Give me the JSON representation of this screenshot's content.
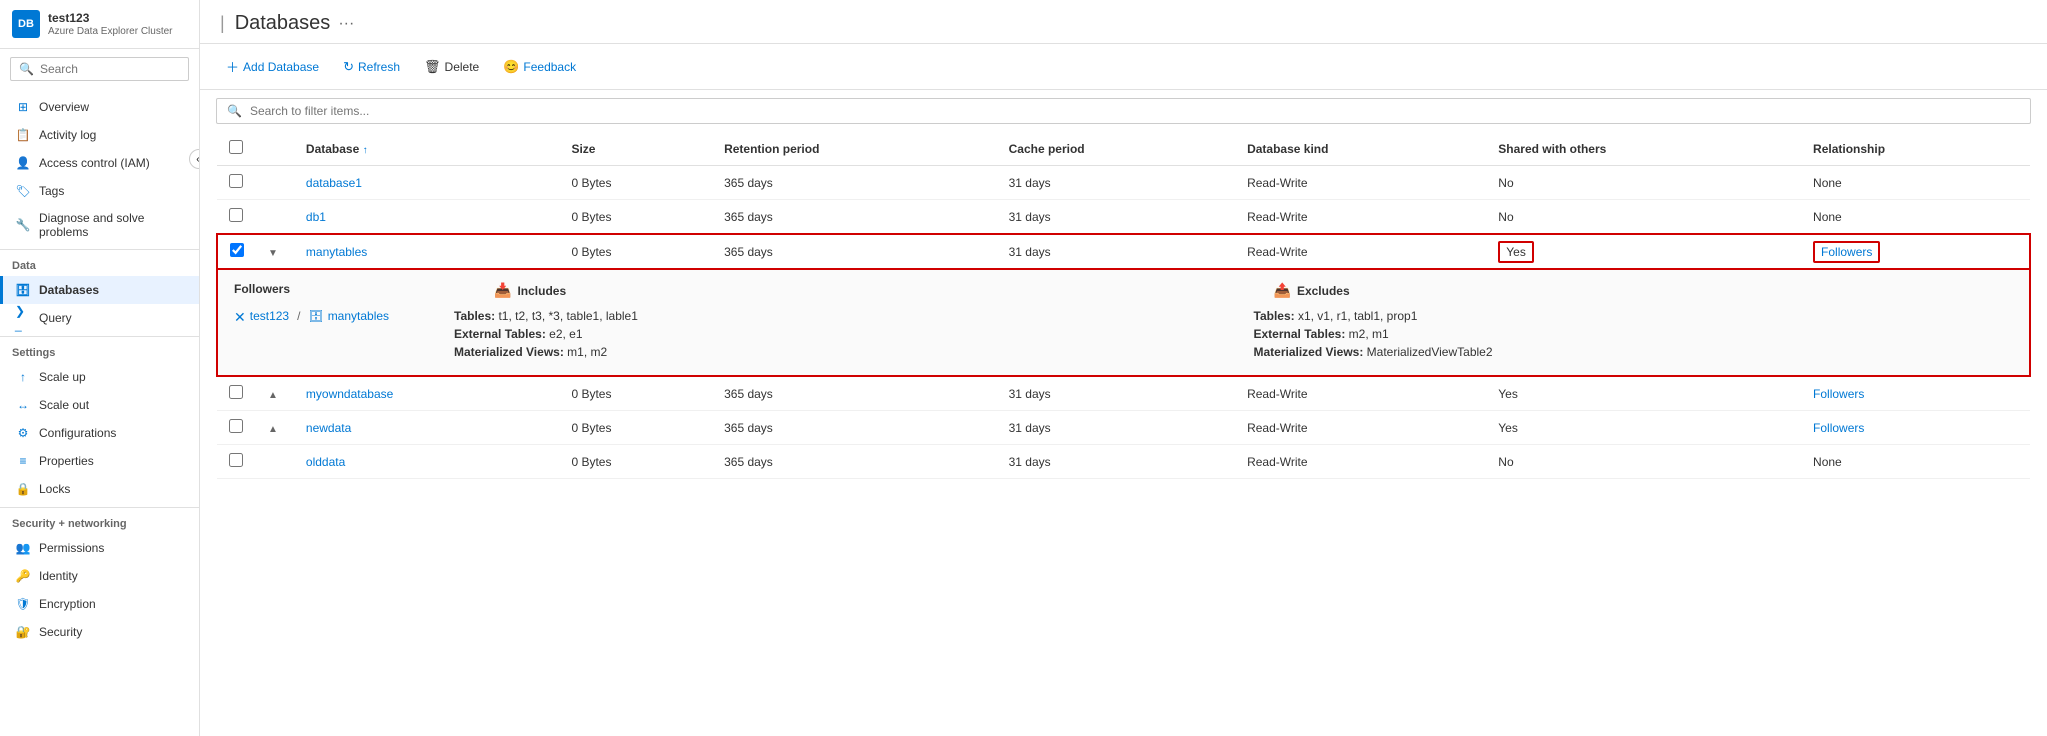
{
  "sidebar": {
    "logo_text": "DB",
    "cluster_name": "test123",
    "cluster_subtitle": "Azure Data Explorer Cluster",
    "search_placeholder": "Search",
    "collapse_icon": "«",
    "nav": {
      "general_items": [
        {
          "id": "overview",
          "label": "Overview",
          "icon": "overview"
        },
        {
          "id": "activity-log",
          "label": "Activity log",
          "icon": "activity"
        },
        {
          "id": "access-control",
          "label": "Access control (IAM)",
          "icon": "access"
        },
        {
          "id": "tags",
          "label": "Tags",
          "icon": "tags"
        },
        {
          "id": "diagnose",
          "label": "Diagnose and solve problems",
          "icon": "diagnose"
        }
      ],
      "data_section": "Data",
      "data_items": [
        {
          "id": "databases",
          "label": "Databases",
          "icon": "db",
          "active": true
        },
        {
          "id": "query",
          "label": "Query",
          "icon": "query"
        }
      ],
      "settings_section": "Settings",
      "settings_items": [
        {
          "id": "scale-up",
          "label": "Scale up",
          "icon": "scale"
        },
        {
          "id": "scale-out",
          "label": "Scale out",
          "icon": "scale-out"
        },
        {
          "id": "configurations",
          "label": "Configurations",
          "icon": "config"
        },
        {
          "id": "properties",
          "label": "Properties",
          "icon": "props"
        },
        {
          "id": "locks",
          "label": "Locks",
          "icon": "locks"
        }
      ],
      "security_section": "Security + networking",
      "security_items": [
        {
          "id": "permissions",
          "label": "Permissions",
          "icon": "permissions"
        },
        {
          "id": "identity",
          "label": "Identity",
          "icon": "identity"
        },
        {
          "id": "encryption",
          "label": "Encryption",
          "icon": "encryption"
        },
        {
          "id": "security",
          "label": "Security",
          "icon": "security"
        }
      ]
    }
  },
  "page": {
    "title": "Databases",
    "more_icon": "···"
  },
  "toolbar": {
    "add_db_label": "Add Database",
    "refresh_label": "Refresh",
    "delete_label": "Delete",
    "feedback_label": "Feedback"
  },
  "search": {
    "placeholder": "Search to filter items..."
  },
  "table": {
    "columns": [
      "",
      "",
      "Database",
      "Size",
      "Retention period",
      "Cache period",
      "Database kind",
      "Shared with others",
      "Relationship"
    ],
    "rows": [
      {
        "id": "database1",
        "name": "database1",
        "size": "0 Bytes",
        "retention": "365 days",
        "cache": "31 days",
        "kind": "Read-Write",
        "shared": "No",
        "relationship": "None",
        "expanded": false,
        "has_followers": false,
        "highlight_row": false,
        "highlight_relationship": false
      },
      {
        "id": "db1",
        "name": "db1",
        "size": "0 Bytes",
        "retention": "365 days",
        "cache": "31 days",
        "kind": "Read-Write",
        "shared": "No",
        "relationship": "None",
        "expanded": false,
        "has_followers": false,
        "highlight_row": false,
        "highlight_relationship": false
      },
      {
        "id": "manytables",
        "name": "manytables",
        "size": "0 Bytes",
        "retention": "365 days",
        "cache": "31 days",
        "kind": "Read-Write",
        "shared": "Yes",
        "relationship": "Followers",
        "expanded": true,
        "has_followers": true,
        "highlight_row": true,
        "highlight_shared": true,
        "highlight_relationship": true
      },
      {
        "id": "myowndatabase",
        "name": "myowndatabase",
        "size": "0 Bytes",
        "retention": "365 days",
        "cache": "31 days",
        "kind": "Read-Write",
        "shared": "Yes",
        "relationship": "Followers",
        "expanded": false,
        "has_followers": true,
        "highlight_row": false,
        "highlight_relationship": false
      },
      {
        "id": "newdata",
        "name": "newdata",
        "size": "0 Bytes",
        "retention": "365 days",
        "cache": "31 days",
        "kind": "Read-Write",
        "shared": "Yes",
        "relationship": "Followers",
        "expanded": false,
        "has_followers": true,
        "highlight_row": false,
        "highlight_relationship": false
      },
      {
        "id": "olddata",
        "name": "olddata",
        "size": "0 Bytes",
        "retention": "365 days",
        "cache": "31 days",
        "kind": "Read-Write",
        "shared": "No",
        "relationship": "None",
        "expanded": false,
        "has_followers": false,
        "highlight_row": false,
        "highlight_relationship": false
      }
    ],
    "follower_detail": {
      "followers_label": "Followers",
      "includes_label": "Includes",
      "excludes_label": "Excludes",
      "cluster": "test123",
      "database": "manytables",
      "includes": {
        "tables": "Tables: t1, t2, t3, *3, table1, lable1",
        "external_tables": "External Tables: e2, e1",
        "materialized_views": "Materialized Views: m1, m2"
      },
      "excludes": {
        "tables": "Tables: x1, v1, r1, tabl1, prop1",
        "external_tables": "External Tables: m2, m1",
        "materialized_views": "Materialized Views: MaterializedViewTable2"
      }
    }
  }
}
